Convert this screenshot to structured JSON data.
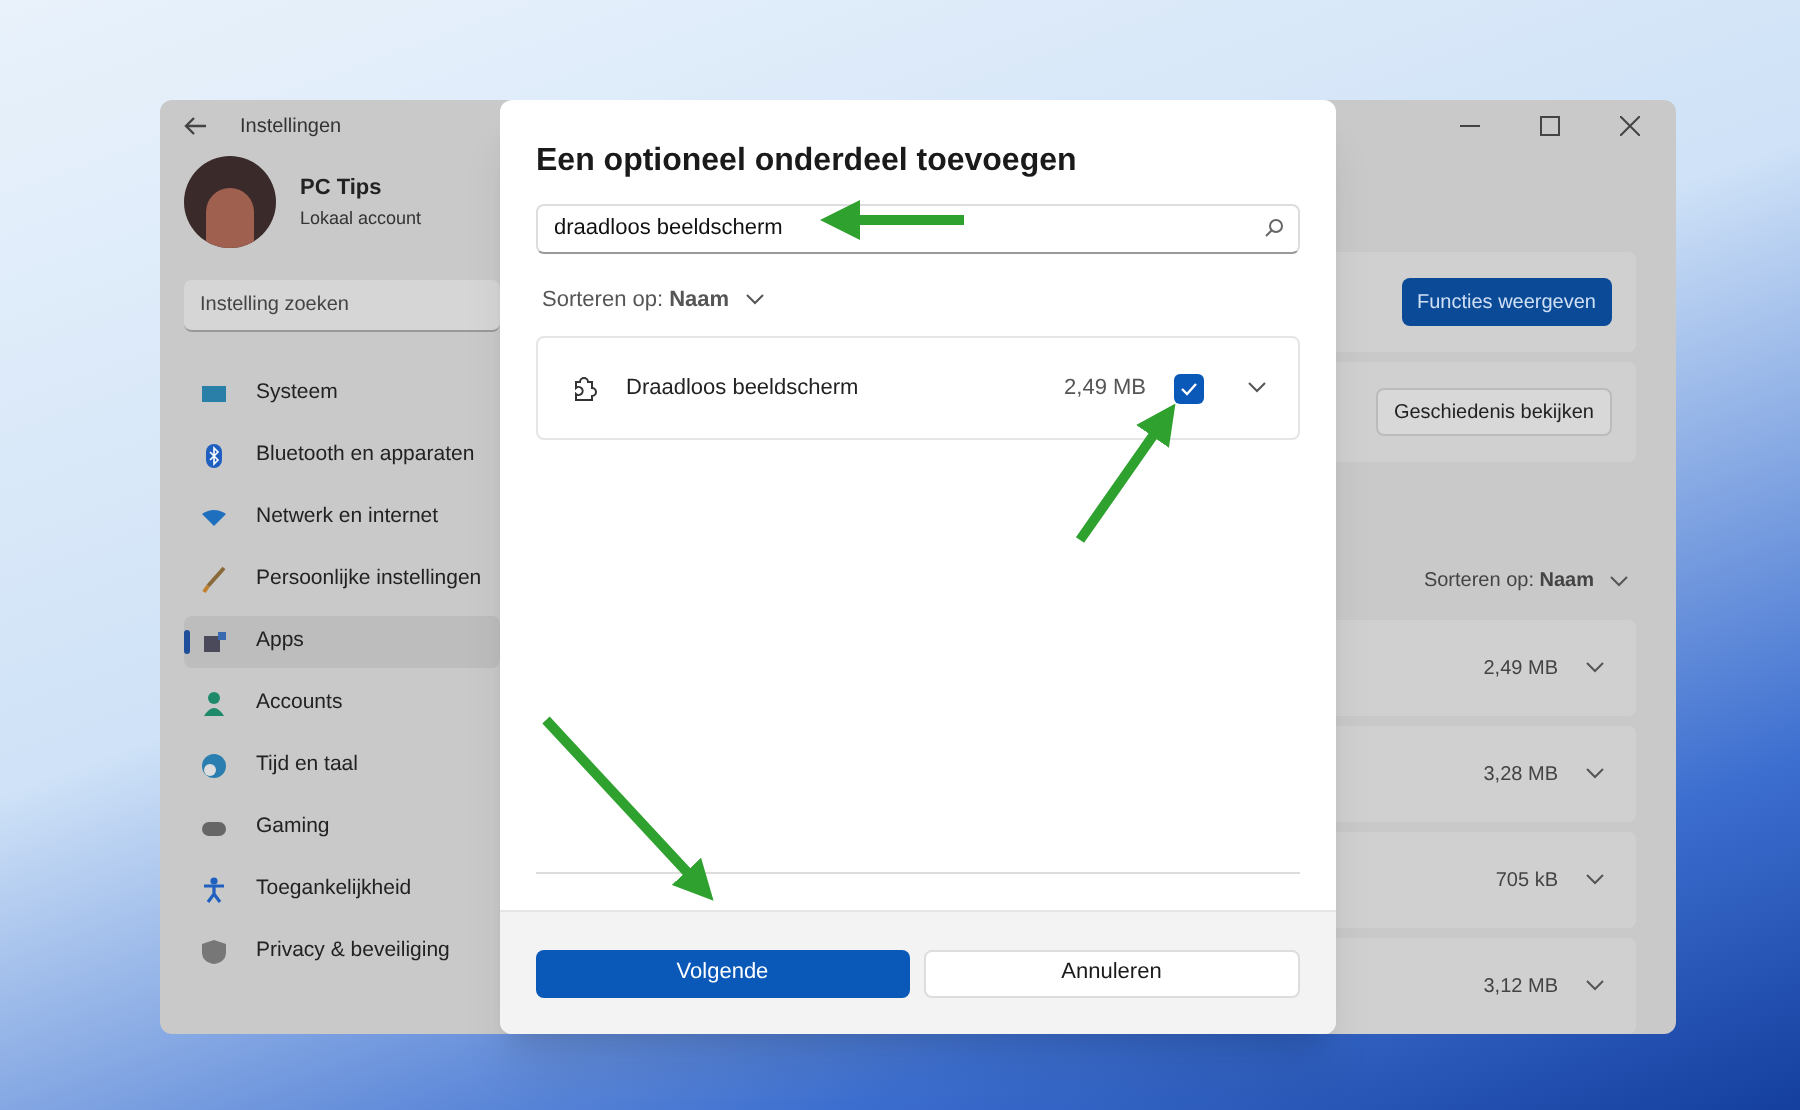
{
  "settings_window": {
    "title": "Instellingen",
    "profile": {
      "name": "PC Tips",
      "account": "Lokaal account"
    },
    "search": {
      "placeholder": "Instelling zoeken"
    },
    "nav": [
      {
        "label": "Systeem",
        "selected": false
      },
      {
        "label": "Bluetooth en apparaten",
        "selected": false
      },
      {
        "label": "Netwerk en internet",
        "selected": false
      },
      {
        "label": "Persoonlijke instellingen",
        "selected": false
      },
      {
        "label": "Apps",
        "selected": true
      },
      {
        "label": "Accounts",
        "selected": false
      },
      {
        "label": "Tijd en taal",
        "selected": false
      },
      {
        "label": "Gaming",
        "selected": false
      },
      {
        "label": "Toegankelijkheid",
        "selected": false
      },
      {
        "label": "Privacy & beveiliging",
        "selected": false
      }
    ],
    "view_features_button": "Functies weergeven",
    "history_button": "Geschiedenis bekijken",
    "sort": "Sorteren op: **Naam**",
    "features": [
      {
        "size": "2,49 MB"
      },
      {
        "size": "3,28 MB"
      },
      {
        "size": "705 kB"
      },
      {
        "size": "3,12 MB"
      }
    ]
  },
  "dialog": {
    "title": "Een optioneel onderdeel toevoegen",
    "search": {
      "value": "draadloos beeldscherm"
    },
    "sort": "Sorteren op: **Naam**",
    "items": [
      {
        "name": "Draadloos beeldscherm",
        "size": "2,49 MB",
        "checked": true
      }
    ],
    "primary_button": "Volgende",
    "secondary_button": "Annuleren"
  }
}
